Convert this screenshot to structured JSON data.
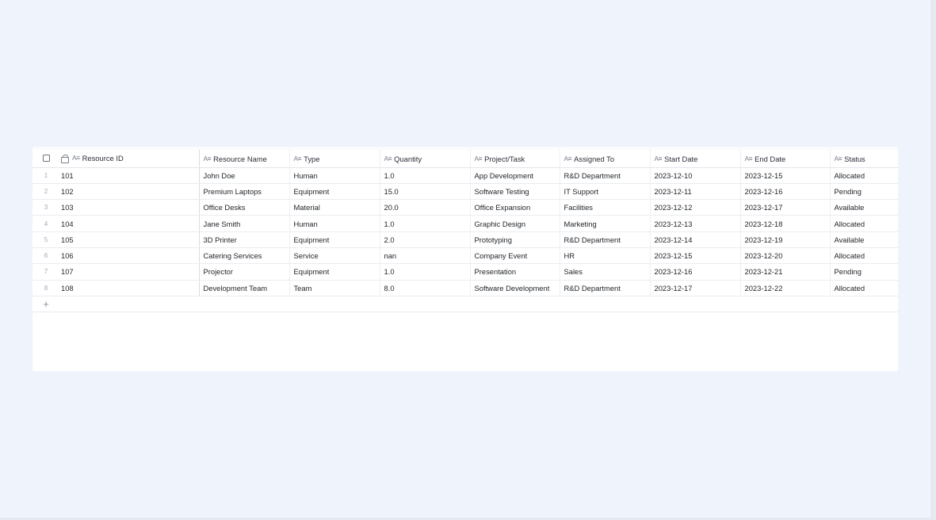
{
  "table": {
    "columns": [
      {
        "label": "Resource ID",
        "locked": true
      },
      {
        "label": "Resource Name"
      },
      {
        "label": "Type"
      },
      {
        "label": "Quantity"
      },
      {
        "label": "Project/Task"
      },
      {
        "label": "Assigned To"
      },
      {
        "label": "Start Date"
      },
      {
        "label": "End Date"
      },
      {
        "label": "Status"
      }
    ],
    "type_icon": "A≡",
    "rows": [
      {
        "n": "1",
        "cells": [
          "101",
          "John Doe",
          "Human",
          "1.0",
          "App Development",
          "R&D Department",
          "2023-12-10",
          "2023-12-15",
          "Allocated"
        ]
      },
      {
        "n": "2",
        "cells": [
          "102",
          "Premium Laptops",
          "Equipment",
          "15.0",
          "Software Testing",
          "IT Support",
          "2023-12-11",
          "2023-12-16",
          "Pending"
        ]
      },
      {
        "n": "3",
        "cells": [
          "103",
          "Office Desks",
          "Material",
          "20.0",
          "Office Expansion",
          "Facilities",
          "2023-12-12",
          "2023-12-17",
          "Available"
        ]
      },
      {
        "n": "4",
        "cells": [
          "104",
          "Jane Smith",
          "Human",
          "1.0",
          "Graphic Design",
          "Marketing",
          "2023-12-13",
          "2023-12-18",
          "Allocated"
        ]
      },
      {
        "n": "5",
        "cells": [
          "105",
          "3D Printer",
          "Equipment",
          "2.0",
          "Prototyping",
          "R&D Department",
          "2023-12-14",
          "2023-12-19",
          "Available"
        ]
      },
      {
        "n": "6",
        "cells": [
          "106",
          "Catering Services",
          "Service",
          "nan",
          "Company Event",
          "HR",
          "2023-12-15",
          "2023-12-20",
          "Allocated"
        ]
      },
      {
        "n": "7",
        "cells": [
          "107",
          "Projector",
          "Equipment",
          "1.0",
          "Presentation",
          "Sales",
          "2023-12-16",
          "2023-12-21",
          "Pending"
        ]
      },
      {
        "n": "8",
        "cells": [
          "108",
          "Development Team",
          "Team",
          "8.0",
          "Software Development",
          "R&D Department",
          "2023-12-17",
          "2023-12-22",
          "Allocated"
        ]
      }
    ],
    "add_row_icon": "+"
  }
}
